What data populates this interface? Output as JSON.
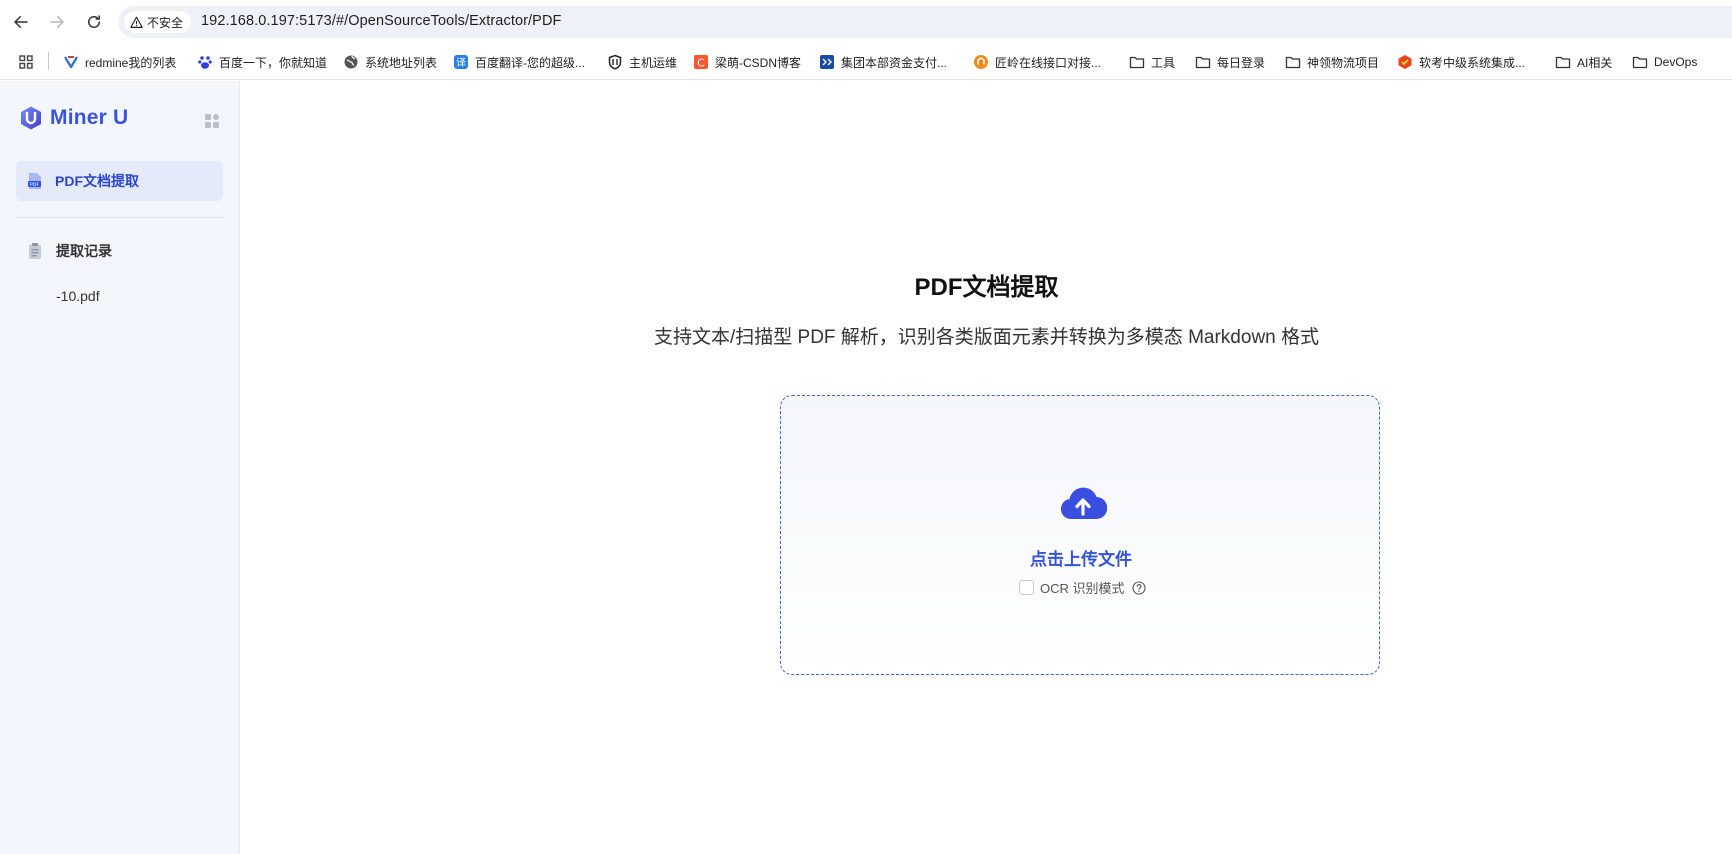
{
  "browser": {
    "security_label": "不安全",
    "url": "192.168.0.197:5173/#/OpenSourceTools/Extractor/PDF",
    "bookmarks": [
      {
        "label": "redmine我的列表",
        "icon": "redmine-icon"
      },
      {
        "label": "百度一下，你就知道",
        "icon": "baidu-icon"
      },
      {
        "label": "系统地址列表",
        "icon": "globe-icon"
      },
      {
        "label": "百度翻译-您的超级...",
        "icon": "translate-icon"
      },
      {
        "label": "主机运维",
        "icon": "shield-icon"
      },
      {
        "label": "梁萌-CSDN博客",
        "icon": "csdn-icon"
      },
      {
        "label": "集团本部资金支付...",
        "icon": "payment-icon"
      },
      {
        "label": "匠岭在线接口对接...",
        "icon": "api-icon"
      },
      {
        "label": "工具",
        "icon": "folder-icon"
      },
      {
        "label": "每日登录",
        "icon": "folder-icon"
      },
      {
        "label": "神领物流项目",
        "icon": "folder-icon"
      },
      {
        "label": "软考中级系统集成...",
        "icon": "exam-icon"
      },
      {
        "label": "AI相关",
        "icon": "folder-icon"
      },
      {
        "label": "DevOps",
        "icon": "folder-icon"
      }
    ]
  },
  "sidebar": {
    "logo_text": "Miner U",
    "active_item": "PDF文档提取",
    "history_title": "提取记录",
    "history_items": [
      "-10.pdf"
    ]
  },
  "main": {
    "title": "PDF文档提取",
    "subtitle": "支持文本/扫描型 PDF 解析，识别各类版面元素并转换为多模态 Markdown 格式",
    "upload_label": "点击上传文件",
    "ocr_label": "OCR 识别模式",
    "ocr_checked": false
  },
  "colors": {
    "accent": "#3552db",
    "upload_border": "#3d63d6",
    "sidebar_bg": "#f3f6fc",
    "active_bg": "#e4eafa"
  }
}
